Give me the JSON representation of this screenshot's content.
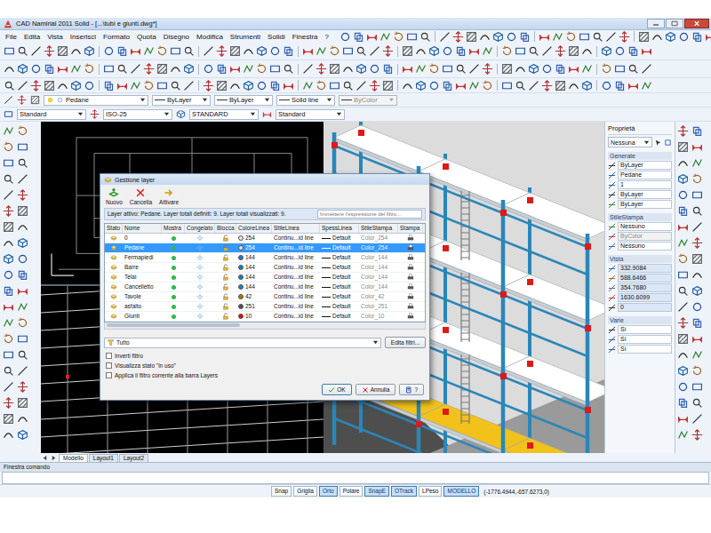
{
  "window": {
    "title": "CAD Namirial 2011 Solid - [...\\tubi e giunti.dwg*]"
  },
  "menu": [
    "File",
    "Edita",
    "Vista",
    "Inserisci",
    "Formato",
    "Quota",
    "Disegno",
    "Modifica",
    "Strumenti",
    "Solidi",
    "Finestra",
    "?"
  ],
  "layer_toolbar": {
    "layer": "Pedane",
    "fields": [
      {
        "text": "ByLayer",
        "disabled": false
      },
      {
        "text": "ByLayer",
        "disabled": false
      },
      {
        "text": "Solid line",
        "disabled": false
      },
      {
        "text": "ByColor",
        "disabled": true
      }
    ]
  },
  "style_toolbar": [
    "Standard",
    "ISO-25",
    "STANDARD",
    "Standard"
  ],
  "layer_dialog": {
    "title": "Gestione layer",
    "actions": [
      "Nuovo",
      "Cancella",
      "Attivare"
    ],
    "info": "Layer attivo: Pedane. Layer totali definiti: 9. Layer totali visualizzati: 9.",
    "filter_placeholder": "Immettere l'espressione del filtro...",
    "columns": [
      "Stato",
      "Nome",
      "Mostra",
      "Congelato",
      "Blocca",
      "ColoreLinea",
      "StileLinea",
      "SpessLinea",
      "StileStampa",
      "Stampa"
    ],
    "rows": [
      {
        "name": "0",
        "visible": true,
        "frozen": false,
        "locked": false,
        "color": "#e6e6e6",
        "color_index": "254",
        "linetype": "Continu...id line",
        "lineweight": "Default",
        "plot_style": "Color_254",
        "plot": true,
        "selected": false
      },
      {
        "name": "Pedane",
        "visible": true,
        "frozen": false,
        "locked": false,
        "color": "#e6e6e6",
        "color_index": "254",
        "linetype": "Continu...id line",
        "lineweight": "Default",
        "plot_style": "Color_254",
        "plot": true,
        "selected": true
      },
      {
        "name": "Fermapiedi",
        "visible": true,
        "frozen": false,
        "locked": false,
        "color": "#1f7fae",
        "color_index": "144",
        "linetype": "Continu...id line",
        "lineweight": "Default",
        "plot_style": "Color_144",
        "plot": true,
        "selected": false
      },
      {
        "name": "Barre",
        "visible": true,
        "frozen": false,
        "locked": false,
        "color": "#1f7fae",
        "color_index": "144",
        "linetype": "Continu...id line",
        "lineweight": "Default",
        "plot_style": "Color_144",
        "plot": true,
        "selected": false
      },
      {
        "name": "Telai",
        "visible": true,
        "frozen": false,
        "locked": false,
        "color": "#1f7fae",
        "color_index": "144",
        "linetype": "Continu...id line",
        "lineweight": "Default",
        "plot_style": "Color_144",
        "plot": true,
        "selected": false
      },
      {
        "name": "Cancelletto",
        "visible": true,
        "frozen": false,
        "locked": false,
        "color": "#1f7fae",
        "color_index": "144",
        "linetype": "Continu...id line",
        "lineweight": "Default",
        "plot_style": "Color_144",
        "plot": true,
        "selected": false
      },
      {
        "name": "Tavole",
        "visible": true,
        "frozen": false,
        "locked": false,
        "color": "#a57c00",
        "color_index": "42",
        "linetype": "Continu...id line",
        "lineweight": "Default",
        "plot_style": "Color_42",
        "plot": true,
        "selected": false
      },
      {
        "name": "asfalto",
        "visible": true,
        "frozen": false,
        "locked": false,
        "color": "#505050",
        "color_index": "251",
        "linetype": "Continu...id line",
        "lineweight": "Default",
        "plot_style": "Color_251",
        "plot": true,
        "selected": false
      },
      {
        "name": "Giunti",
        "visible": true,
        "frozen": false,
        "locked": false,
        "color": "#e01010",
        "color_index": "10",
        "linetype": "Continu...id line",
        "lineweight": "Default",
        "plot_style": "Color_10",
        "plot": true,
        "selected": false
      }
    ],
    "filter": "Tutto",
    "edit_filters": "Edita filtri...",
    "options": [
      {
        "label": "Inverti filtro",
        "checked": false
      },
      {
        "label": "Visualizza stato \"in uso\"",
        "checked": false
      },
      {
        "label": "Applica il filtro corrente alla barra Layers",
        "checked": false
      }
    ],
    "buttons": [
      "OK",
      "Annulla",
      "?"
    ]
  },
  "properties": {
    "title": "Proprietà",
    "selection": "Nessuna",
    "sections": [
      {
        "title": "Generale",
        "values": [
          {
            "text": "ByLayer",
            "disabled": false
          },
          {
            "text": "Pedane",
            "disabled": false
          },
          {
            "text": "1",
            "disabled": false
          },
          {
            "text": "ByLayer",
            "disabled": false
          },
          {
            "text": "ByLayer",
            "disabled": false
          }
        ]
      },
      {
        "title": "StileStampa",
        "values": [
          {
            "text": "Nessuno",
            "disabled": false
          },
          {
            "text": "ByColor",
            "disabled": true
          },
          {
            "text": "Nessuno",
            "disabled": false
          }
        ]
      },
      {
        "title": "Vista",
        "values": [
          {
            "text": "332.9084",
            "disabled": false
          },
          {
            "text": "588.6466",
            "disabled": false
          },
          {
            "text": "354.7680",
            "disabled": false
          },
          {
            "text": "1630.6099",
            "disabled": false
          },
          {
            "text": "0",
            "disabled": false
          }
        ]
      },
      {
        "title": "Varie",
        "values": [
          {
            "text": "Sì",
            "disabled": false
          },
          {
            "text": "Sì",
            "disabled": false
          },
          {
            "text": "Sì",
            "disabled": false
          }
        ]
      }
    ]
  },
  "layout_tabs": [
    {
      "label": "Modello",
      "selected": true
    },
    {
      "label": "Layout1",
      "selected": false
    },
    {
      "label": "Layout2",
      "selected": false
    }
  ],
  "command": {
    "title": "Finestra comando"
  },
  "status_bar": {
    "toggles": [
      {
        "label": "Snap",
        "on": false
      },
      {
        "label": "Griglia",
        "on": false
      },
      {
        "label": "Orto",
        "on": true
      },
      {
        "label": "Polare",
        "on": false
      },
      {
        "label": "SnapE",
        "on": true
      },
      {
        "label": "OTrack",
        "on": true
      },
      {
        "label": "LPeso",
        "on": false
      },
      {
        "label": "MODELLO",
        "on": true
      }
    ],
    "coordinates": "(-1776.4944,-657.6273,0)"
  }
}
